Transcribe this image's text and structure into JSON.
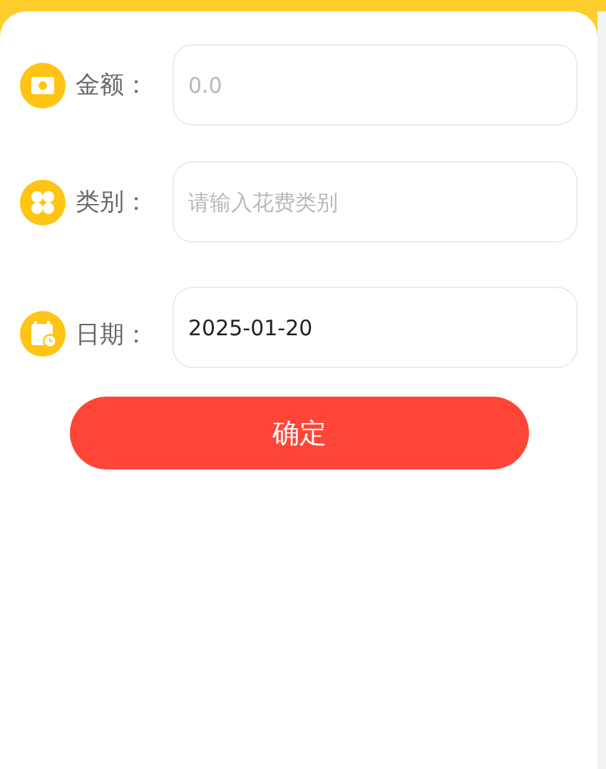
{
  "form": {
    "fields": [
      {
        "kind": "amount",
        "label": "金额：",
        "placeholder": "0.0"
      },
      {
        "kind": "text",
        "label": "类别：",
        "placeholder": "请输入花费类别"
      },
      {
        "kind": "date",
        "label": "日期：",
        "value": "2025-01-20"
      }
    ]
  },
  "submit_button": "确定"
}
